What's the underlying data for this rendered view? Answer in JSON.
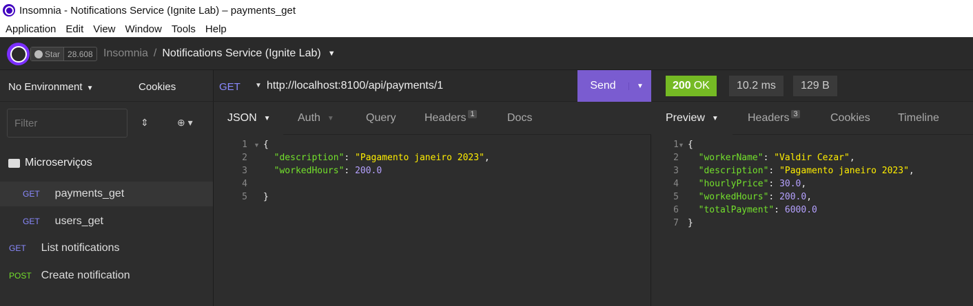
{
  "window": {
    "title": "Insomnia - Notifications Service (Ignite Lab) – payments_get"
  },
  "menu": [
    "Application",
    "Edit",
    "View",
    "Window",
    "Tools",
    "Help"
  ],
  "header": {
    "star_label": "Star",
    "star_count": "28.608",
    "workspace": "Insomnia",
    "separator": "/",
    "project": "Notifications Service (Ignite Lab)"
  },
  "sidebar": {
    "environment": "No Environment",
    "cookies": "Cookies",
    "filter_placeholder": "Filter",
    "folder": "Microserviços",
    "requests": [
      {
        "method": "GET",
        "name": "payments_get",
        "active": true
      },
      {
        "method": "GET",
        "name": "users_get"
      },
      {
        "method": "GET",
        "name": "List notifications"
      },
      {
        "method": "POST",
        "name": "Create notification"
      }
    ]
  },
  "request": {
    "method": "GET",
    "url": "http://localhost:8100/api/payments/1",
    "send": "Send",
    "tabs": {
      "body": "JSON",
      "auth": "Auth",
      "query": "Query",
      "headers": "Headers",
      "headers_count": "1",
      "docs": "Docs"
    },
    "body_lines": [
      {
        "n": "1",
        "text": "{"
      },
      {
        "n": "2",
        "key": "\"description\"",
        "value": "\"Pagamento janeiro 2023\"",
        "type": "s",
        "trail": ","
      },
      {
        "n": "3",
        "key": "\"workedHours\"",
        "value": "200.0",
        "type": "n",
        "trail": ""
      },
      {
        "n": "4",
        "text": ""
      },
      {
        "n": "5",
        "text": "}"
      }
    ]
  },
  "response": {
    "status_code": "200",
    "status_text": "OK",
    "time": "10.2 ms",
    "size": "129 B",
    "tabs": {
      "preview": "Preview",
      "headers": "Headers",
      "headers_count": "3",
      "cookies": "Cookies",
      "timeline": "Timeline"
    },
    "body_lines": [
      {
        "n": "1",
        "text": "{"
      },
      {
        "n": "2",
        "key": "\"workerName\"",
        "value": "\"Valdir Cezar\"",
        "type": "s",
        "trail": ","
      },
      {
        "n": "3",
        "key": "\"description\"",
        "value": "\"Pagamento janeiro 2023\"",
        "type": "s",
        "trail": ","
      },
      {
        "n": "4",
        "key": "\"hourlyPrice\"",
        "value": "30.0",
        "type": "n",
        "trail": ","
      },
      {
        "n": "5",
        "key": "\"workedHours\"",
        "value": "200.0",
        "type": "n",
        "trail": ","
      },
      {
        "n": "6",
        "key": "\"totalPayment\"",
        "value": "6000.0",
        "type": "n",
        "trail": ""
      },
      {
        "n": "7",
        "text": "}"
      }
    ]
  }
}
